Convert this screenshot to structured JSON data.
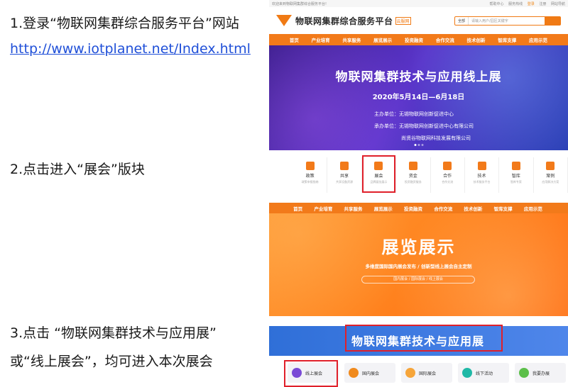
{
  "steps": {
    "step1": "1.登录“物联网集群综合服务平台”网站",
    "step1_link": "http://www.iotplanet.net/Index.html",
    "step2": "2.点击进入“展会”版块",
    "step3_line1": "3.点击 “物联网集群技术与应用展”",
    "step3_line2": "或“线上展会”，均可进入本次展会"
  },
  "home": {
    "topbar_left": "欢迎来到物联网集群综合服务平台!",
    "topbar_right": [
      "帮助中心",
      "服务热线",
      "登录",
      "注册",
      "网站导航"
    ],
    "logo_text": "物联网集群综合服务平台",
    "logo_sub": "云服网",
    "search_category": "全部",
    "search_placeholder": "请输入用户/园区关键字",
    "nav": [
      "首页",
      "产业培育",
      "共享服务",
      "展览展示",
      "投资融资",
      "合作交流",
      "技术创新",
      "智库支撑",
      "应用示范"
    ],
    "banner_title": "物联网集群技术与应用线上展",
    "banner_date": "2020年5月14日—6月18日",
    "banner_host": "主办单位：无锡物联网创新促进中心",
    "banner_organizer": "承办单位：无锡物联网创新促进中心有限公司",
    "banner_organizer2": "尚贤谷物联网科技发展有限公司"
  },
  "sections": [
    {
      "name": "政策",
      "desc": "政策申报指南"
    },
    {
      "name": "共享",
      "desc": "共享设备资源"
    },
    {
      "name": "展会",
      "desc": "品牌展览展示"
    },
    {
      "name": "资金",
      "desc": "投资融资服务"
    },
    {
      "name": "合作",
      "desc": "合作交流"
    },
    {
      "name": "技术",
      "desc": "技术服务平台"
    },
    {
      "name": "智库",
      "desc": "智库专家"
    },
    {
      "name": "案例",
      "desc": "应用解决方案"
    }
  ],
  "expo": {
    "nav": [
      "首页",
      "产业培育",
      "共享服务",
      "展览展示",
      "投资融资",
      "合作交流",
      "技术创新",
      "智库支撑",
      "应用示范"
    ],
    "title": "展览展示",
    "subtitle": "多维度国际国内展会发布 / 创新型线上展会自主定制",
    "tags": "国内展会 / 国际展会 / 线上展会",
    "banner_title": "物联网集群技术与应用展",
    "cards": [
      {
        "label": "线上展会",
        "color": "#7a4bd6"
      },
      {
        "label": "国内展会",
        "color": "#f08a1d"
      },
      {
        "label": "国际展会",
        "color": "#f6a53a"
      },
      {
        "label": "线下活动",
        "color": "#1fb8a6"
      },
      {
        "label": "我要办展",
        "color": "#5cbf4a"
      }
    ]
  },
  "colors": {
    "accent": "#f27a1a",
    "highlight": "#e0202a",
    "link": "#1f4fd8"
  }
}
